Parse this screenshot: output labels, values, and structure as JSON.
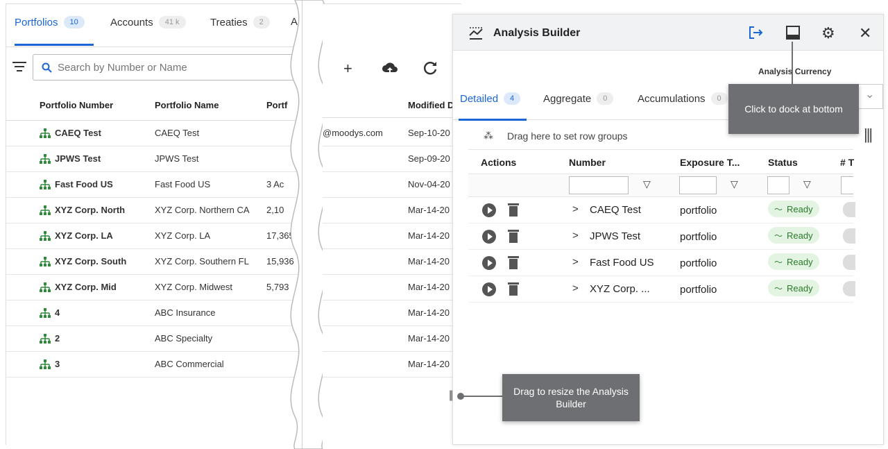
{
  "portfolios_panel": {
    "tabs": [
      {
        "label": "Portfolios",
        "count": "10"
      },
      {
        "label": "Accounts",
        "count": "41 k"
      },
      {
        "label": "Treaties",
        "count": "2"
      },
      {
        "label": "A",
        "count": ""
      }
    ],
    "search_placeholder": "Search by Number or Name",
    "columns": [
      "Portfolio Number",
      "Portfolio Name",
      "Portf",
      "Modified D"
    ],
    "rows": [
      {
        "number": "CAEQ Test",
        "name": "CAEQ Test",
        "portf": "",
        "modified_by": "@moodys.com",
        "modified": "Sep-10-20"
      },
      {
        "number": "JPWS Test",
        "name": "JPWS Test",
        "portf": "",
        "modified_by": "",
        "modified": "Sep-09-20"
      },
      {
        "number": "Fast Food US",
        "name": "Fast Food US",
        "portf": "3 Ac",
        "modified_by": "",
        "modified": "Nov-04-20"
      },
      {
        "number": "XYZ Corp. North",
        "name": "XYZ Corp. Northern CA",
        "portf": "2,10",
        "modified_by": "",
        "modified": "Mar-14-20"
      },
      {
        "number": "XYZ Corp. LA",
        "name": "XYZ Corp. LA",
        "portf": "17,365",
        "modified_by": "",
        "modified": "Mar-14-20"
      },
      {
        "number": "XYZ Corp. South",
        "name": "XYZ Corp. Southern FL",
        "portf": "15,936",
        "modified_by": "",
        "modified": "Mar-14-20"
      },
      {
        "number": "XYZ Corp. Mid",
        "name": "XYZ Corp. Midwest",
        "portf": "5,793",
        "modified_by": "",
        "modified": "Mar-14-20"
      },
      {
        "number": "4",
        "name": "ABC Insurance",
        "portf": "",
        "modified_by": "",
        "modified": "Mar-14-20"
      },
      {
        "number": "2",
        "name": "ABC Specialty",
        "portf": "",
        "modified_by": "",
        "modified": "Mar-14-20"
      },
      {
        "number": "3",
        "name": "ABC Commercial",
        "portf": "",
        "modified_by": "",
        "modified": "Mar-14-20"
      }
    ]
  },
  "toolbar": {
    "add_icon": "plus-icon",
    "upload_icon": "cloud-upload-icon",
    "refresh_icon": "refresh-icon"
  },
  "analysis_builder": {
    "title": "Analysis Builder",
    "currency_label": "Analysis Currency",
    "tabs": [
      {
        "label": "Detailed",
        "count": "4"
      },
      {
        "label": "Aggregate",
        "count": "0"
      },
      {
        "label": "Accumulations",
        "count": "0"
      }
    ],
    "row_groups_hint": "Drag here to set row groups",
    "columns": [
      "Actions",
      "Number",
      "Exposure T...",
      "Status",
      "# T"
    ],
    "rows": [
      {
        "number": "CAEQ Test",
        "exposure": "portfolio",
        "status": "Ready"
      },
      {
        "number": "JPWS Test",
        "exposure": "portfolio",
        "status": "Ready"
      },
      {
        "number": "Fast Food US",
        "exposure": "portfolio",
        "status": "Ready"
      },
      {
        "number": "XYZ Corp. ...",
        "exposure": "portfolio",
        "status": "Ready"
      }
    ]
  },
  "tooltips": {
    "dock": "Click to dock at bottom",
    "resize": "Drag to resize the Analysis Builder"
  },
  "colors": {
    "accent": "#1a66d6",
    "tooltip": "#6d6f72",
    "ready_bg": "#e3f4e3",
    "hierarchy_icon": "#2e8b3a"
  }
}
